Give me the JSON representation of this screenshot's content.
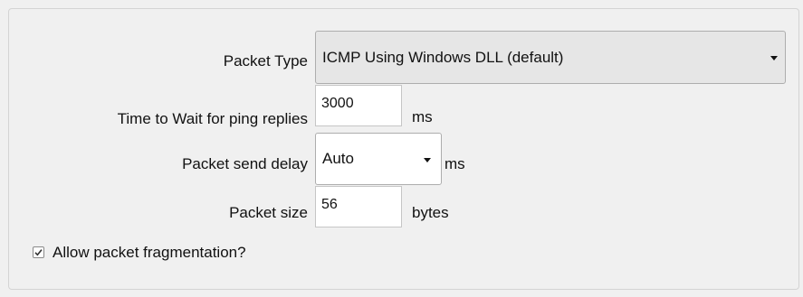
{
  "form": {
    "packet_type": {
      "label": "Packet Type",
      "selected": "ICMP Using Windows DLL (default)",
      "icon": "chevron-down-icon"
    },
    "wait_time": {
      "label": "Time to Wait for ping replies",
      "value": "3000",
      "unit": "ms"
    },
    "send_delay": {
      "label": "Packet send delay",
      "selected": "Auto",
      "unit": "ms",
      "icon": "chevron-down-icon"
    },
    "packet_size": {
      "label": "Packet size",
      "value": "56",
      "unit": "bytes"
    },
    "fragmentation": {
      "label": "Allow packet fragmentation?",
      "checked": true,
      "icon": "checkmark-icon"
    }
  }
}
